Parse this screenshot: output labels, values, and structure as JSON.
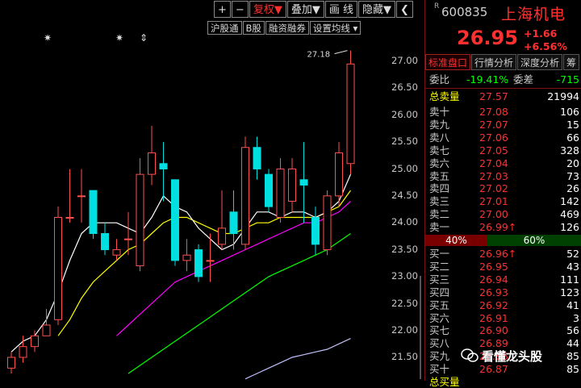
{
  "toolbar": {
    "plus": "+",
    "minus": "−",
    "restore": "复权▼",
    "overlay": "叠加▼",
    "draw": "画 线",
    "hide": "隐藏▼"
  },
  "toolbar2": {
    "hgt": "沪股通",
    "b_share": "B股",
    "margin": "融资融券",
    "ma_set": "设置均线 ▾"
  },
  "stars": [
    "✷",
    "✷",
    "⇕"
  ],
  "annotation": "27.18",
  "y_labels": [
    "27.00",
    "26.50",
    "26.00",
    "25.50",
    "25.00",
    "24.50",
    "24.00",
    "23.50",
    "23.00",
    "22.50",
    "22.00",
    "21.50"
  ],
  "colors": {
    "up": "#ff5050",
    "down": "#00e0e0",
    "ma5": "#ffffff",
    "ma10": "#ffff00",
    "ma20": "#ff00ff",
    "ma60": "#00ff00",
    "ma_long": "#c0c0ff",
    "accent": "#ff3030"
  },
  "stock": {
    "code": "600835",
    "name": "上海机电",
    "price": "26.95",
    "change": "+1.66",
    "change_pct": "+6.56%"
  },
  "tabs": [
    "标准盘口",
    "行情分析",
    "深度分析",
    "筹"
  ],
  "stats": {
    "weibi_label": "委比",
    "weibi_value": "-19.41%",
    "weicha_label": "委差",
    "weicha_value": "-715"
  },
  "sell_total": {
    "label": "总卖量",
    "price": "27.57",
    "vol": "21994"
  },
  "sells": [
    {
      "label": "卖十",
      "price": "27.08",
      "vol": "106"
    },
    {
      "label": "卖九",
      "price": "27.07",
      "vol": "15"
    },
    {
      "label": "卖八",
      "price": "27.06",
      "vol": "66"
    },
    {
      "label": "卖七",
      "price": "27.05",
      "vol": "328"
    },
    {
      "label": "卖六",
      "price": "27.04",
      "vol": "20"
    },
    {
      "label": "卖五",
      "price": "27.03",
      "vol": "73"
    },
    {
      "label": "卖四",
      "price": "27.02",
      "vol": "26"
    },
    {
      "label": "卖三",
      "price": "27.01",
      "vol": "142"
    },
    {
      "label": "卖二",
      "price": "27.00",
      "vol": "469"
    },
    {
      "label": "卖一",
      "price": "26.99↑",
      "vol": "126"
    }
  ],
  "ratio": {
    "left": "40%",
    "right": "60%"
  },
  "buys": [
    {
      "label": "买一",
      "price": "26.96↑",
      "vol": "52"
    },
    {
      "label": "买二",
      "price": "26.95",
      "vol": "43"
    },
    {
      "label": "买三",
      "price": "26.94",
      "vol": "111"
    },
    {
      "label": "买四",
      "price": "26.93",
      "vol": "123"
    },
    {
      "label": "买五",
      "price": "26.92",
      "vol": "41"
    },
    {
      "label": "买六",
      "price": "26.91",
      "vol": "3"
    },
    {
      "label": "买七",
      "price": "26.90",
      "vol": "56"
    },
    {
      "label": "买八",
      "price": "26.89",
      "vol": "44"
    },
    {
      "label": "买九",
      "price": "26.88",
      "vol": "85"
    },
    {
      "label": "买十",
      "price": "26.87",
      "vol": "85"
    }
  ],
  "buy_total_label": "总买量",
  "watermark": "看懂龙头股",
  "chart_data": {
    "type": "candlestick",
    "ylim": [
      21.2,
      27.2
    ],
    "candles": [
      {
        "o": 21.3,
        "c": 21.5,
        "h": 21.6,
        "l": 21.2
      },
      {
        "o": 21.5,
        "c": 21.7,
        "h": 21.9,
        "l": 21.4
      },
      {
        "o": 21.7,
        "c": 21.9,
        "h": 22.0,
        "l": 21.6
      },
      {
        "o": 21.9,
        "c": 22.1,
        "h": 22.4,
        "l": 21.9
      },
      {
        "o": 22.2,
        "c": 24.1,
        "h": 24.3,
        "l": 22.1
      },
      {
        "o": 24.1,
        "c": 24.1,
        "h": 25.0,
        "l": 24.0
      },
      {
        "o": 24.5,
        "c": 24.5,
        "h": 25.0,
        "l": 24.0
      },
      {
        "o": 24.6,
        "c": 23.8,
        "h": 24.6,
        "l": 23.7
      },
      {
        "o": 23.8,
        "c": 23.5,
        "h": 24.0,
        "l": 23.4
      },
      {
        "o": 23.4,
        "c": 23.5,
        "h": 23.7,
        "l": 23.3
      },
      {
        "o": 23.7,
        "c": 23.7,
        "h": 24.2,
        "l": 23.4
      },
      {
        "o": 23.2,
        "c": 24.9,
        "h": 25.2,
        "l": 23.1
      },
      {
        "o": 24.9,
        "c": 25.3,
        "h": 25.8,
        "l": 24.7
      },
      {
        "o": 25.1,
        "c": 25.0,
        "h": 25.5,
        "l": 24.4
      },
      {
        "o": 24.8,
        "c": 23.3,
        "h": 24.8,
        "l": 23.2
      },
      {
        "o": 23.3,
        "c": 23.4,
        "h": 23.7,
        "l": 23.1
      },
      {
        "o": 23.5,
        "c": 23.0,
        "h": 23.6,
        "l": 22.9
      },
      {
        "o": 23.3,
        "c": 23.3,
        "h": 23.8,
        "l": 22.9
      },
      {
        "o": 23.6,
        "c": 23.9,
        "h": 24.6,
        "l": 23.5
      },
      {
        "o": 24.2,
        "c": 23.8,
        "h": 24.6,
        "l": 23.5
      },
      {
        "o": 23.6,
        "c": 25.4,
        "h": 25.6,
        "l": 23.5
      },
      {
        "o": 25.4,
        "c": 25.0,
        "h": 25.6,
        "l": 24.8
      },
      {
        "o": 24.9,
        "c": 24.3,
        "h": 25.0,
        "l": 24.2
      },
      {
        "o": 24.1,
        "c": 25.0,
        "h": 25.2,
        "l": 24.0
      },
      {
        "o": 24.4,
        "c": 25.0,
        "h": 25.2,
        "l": 24.2
      },
      {
        "o": 24.8,
        "c": 24.7,
        "h": 25.5,
        "l": 24.0
      },
      {
        "o": 24.1,
        "c": 23.6,
        "h": 24.3,
        "l": 23.4
      },
      {
        "o": 23.5,
        "c": 24.5,
        "h": 24.6,
        "l": 23.4
      },
      {
        "o": 24.5,
        "c": 25.3,
        "h": 25.5,
        "l": 24.3
      },
      {
        "o": 25.1,
        "c": 26.95,
        "h": 27.2,
        "l": 24.9
      }
    ],
    "ma5": [
      21.6,
      21.8,
      21.9,
      22.2,
      22.7,
      23.3,
      23.8,
      24.0,
      24.0,
      24.0,
      23.9,
      23.8,
      24.1,
      24.5,
      24.3,
      24.2,
      23.9,
      23.7,
      23.5,
      23.6,
      23.9,
      24.2,
      24.2,
      24.1,
      24.2,
      24.2,
      24.1,
      24.2,
      24.4,
      24.9
    ],
    "ma10": [
      null,
      null,
      null,
      null,
      21.9,
      22.2,
      22.6,
      22.9,
      23.1,
      23.3,
      23.5,
      23.6,
      23.8,
      24.0,
      24.1,
      24.1,
      24.0,
      23.9,
      23.8,
      23.8,
      23.9,
      24.0,
      24.0,
      24.1,
      24.1,
      24.1,
      24.1,
      24.2,
      24.3,
      24.6
    ],
    "ma20": [
      null,
      null,
      null,
      null,
      null,
      null,
      null,
      null,
      null,
      21.9,
      22.1,
      22.3,
      22.5,
      22.7,
      22.9,
      23.0,
      23.1,
      23.2,
      23.3,
      23.4,
      23.5,
      23.6,
      23.7,
      23.8,
      23.9,
      24.0,
      24.0,
      24.1,
      24.2,
      24.4
    ],
    "ma60": [
      null,
      null,
      null,
      null,
      null,
      null,
      null,
      null,
      null,
      null,
      21.2,
      21.35,
      21.5,
      21.65,
      21.8,
      21.95,
      22.1,
      22.25,
      22.4,
      22.55,
      22.7,
      22.85,
      23.0,
      23.1,
      23.2,
      23.3,
      23.4,
      23.5,
      23.65,
      23.8
    ],
    "ma_long": [
      null,
      null,
      null,
      null,
      null,
      null,
      null,
      null,
      null,
      null,
      null,
      null,
      null,
      null,
      null,
      null,
      null,
      null,
      null,
      null,
      21.1,
      21.2,
      21.3,
      21.4,
      21.5,
      21.55,
      21.6,
      21.65,
      21.75,
      21.85
    ]
  }
}
